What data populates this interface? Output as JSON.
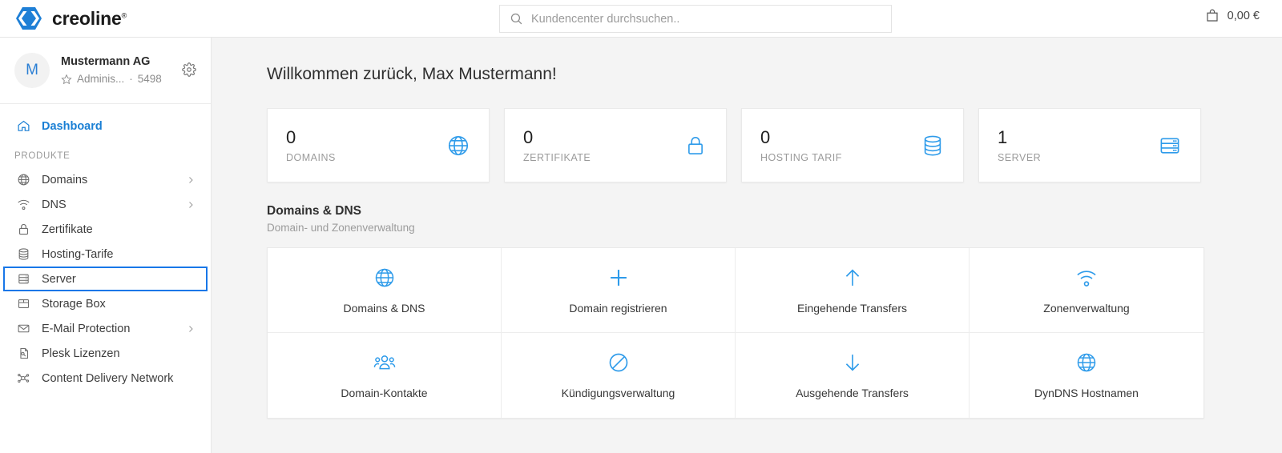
{
  "brand": {
    "name": "creoline",
    "trademark": "®",
    "logo_icon": "creoline-hexagon-logo"
  },
  "search": {
    "placeholder": "Kundencenter durchsuchen..",
    "value": "",
    "icon": "search-icon"
  },
  "cart": {
    "amount": "0,00 €",
    "icon": "shopping-bag-icon"
  },
  "account": {
    "avatar_initial": "M",
    "name": "Mustermann AG",
    "role": "Adminis...",
    "separator": "·",
    "customer_number": "5498",
    "star_icon": "star-icon",
    "settings_icon": "gear-icon"
  },
  "sidebar": {
    "dashboard": {
      "label": "Dashboard",
      "icon": "home-icon"
    },
    "section_label": "PRODUKTE",
    "items": [
      {
        "label": "Domains",
        "icon": "globe-icon",
        "chevron": true
      },
      {
        "label": "DNS",
        "icon": "wifi-icon",
        "chevron": true
      },
      {
        "label": "Zertifikate",
        "icon": "lock-icon",
        "chevron": false
      },
      {
        "label": "Hosting-Tarife",
        "icon": "database-icon",
        "chevron": false
      },
      {
        "label": "Server",
        "icon": "server-icon",
        "chevron": false,
        "focused": true
      },
      {
        "label": "Storage Box",
        "icon": "box-icon",
        "chevron": false
      },
      {
        "label": "E-Mail Protection",
        "icon": "mail-icon",
        "chevron": true
      },
      {
        "label": "Plesk Lizenzen",
        "icon": "license-icon",
        "chevron": false
      },
      {
        "label": "Content Delivery Network",
        "icon": "network-icon",
        "chevron": false
      }
    ]
  },
  "main": {
    "page_title": "Willkommen zurück, Max Mustermann!",
    "stats": [
      {
        "value": "0",
        "label": "DOMAINS",
        "icon": "globe-icon"
      },
      {
        "value": "0",
        "label": "ZERTIFIKATE",
        "icon": "lock-icon"
      },
      {
        "value": "0",
        "label": "HOSTING TARIF",
        "icon": "database-icon"
      },
      {
        "value": "1",
        "label": "SERVER",
        "icon": "server-icon"
      }
    ],
    "section": {
      "title": "Domains & DNS",
      "subtitle": "Domain- und Zonenverwaltung"
    },
    "tiles": [
      {
        "label": "Domains & DNS",
        "icon": "globe-icon"
      },
      {
        "label": "Domain registrieren",
        "icon": "plus-icon"
      },
      {
        "label": "Eingehende Transfers",
        "icon": "arrow-up-icon"
      },
      {
        "label": "Zonenverwaltung",
        "icon": "wifi-icon"
      },
      {
        "label": "Domain-Kontakte",
        "icon": "users-icon"
      },
      {
        "label": "Kündigungsverwaltung",
        "icon": "ban-icon"
      },
      {
        "label": "Ausgehende Transfers",
        "icon": "arrow-down-icon"
      },
      {
        "label": "DynDNS Hostnamen",
        "icon": "globe-icon"
      }
    ]
  },
  "colors": {
    "accent": "#2e9bea",
    "link": "#1a7fd4",
    "focus": "#1877e8",
    "logo": "#1e7fd6"
  }
}
